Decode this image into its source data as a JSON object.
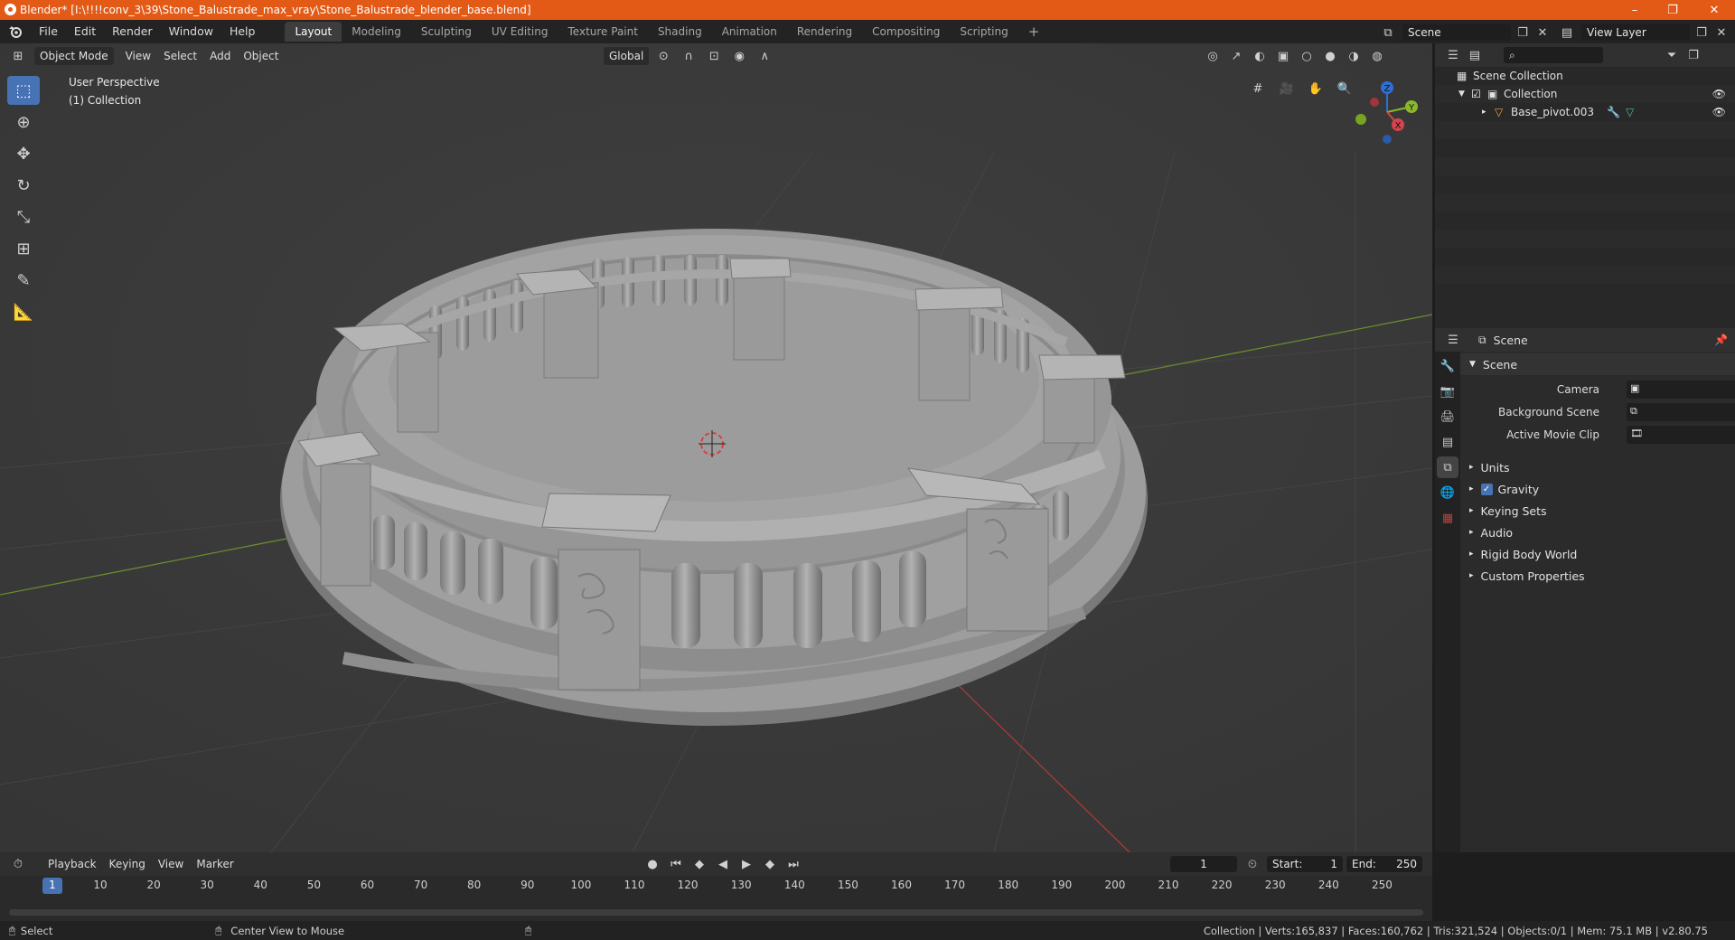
{
  "window": {
    "title": "Blender* [I:\\!!!!conv_3\\39\\Stone_Balustrade_max_vray\\Stone_Balustrade_blender_base.blend]",
    "minimize": "–",
    "maximize": "❐",
    "close": "✕"
  },
  "menubar": {
    "items": [
      "File",
      "Edit",
      "Render",
      "Window",
      "Help"
    ],
    "workspaces": [
      "Layout",
      "Modeling",
      "Sculpting",
      "UV Editing",
      "Texture Paint",
      "Shading",
      "Animation",
      "Rendering",
      "Compositing",
      "Scripting"
    ],
    "add_tab": "+",
    "scene": "Scene",
    "view_layer": "View Layer"
  },
  "viewport": {
    "mode": "Object Mode",
    "menus": [
      "View",
      "Select",
      "Add",
      "Object"
    ],
    "orientation": "Global",
    "perspective": "User Perspective",
    "collection": "(1) Collection",
    "gizmo": {
      "z": "Z",
      "y": "Y",
      "x": "X"
    }
  },
  "outliner": {
    "search_placeholder": "",
    "scene_collection": "Scene Collection",
    "collection": "Collection",
    "object": "Base_pivot.003"
  },
  "properties": {
    "context": "Scene",
    "panel_title": "Scene",
    "camera_label": "Camera",
    "background_scene_label": "Background Scene",
    "active_movie_clip_label": "Active Movie Clip",
    "sections": [
      "Units",
      "Gravity",
      "Keying Sets",
      "Audio",
      "Rigid Body World",
      "Custom Properties"
    ]
  },
  "timeline": {
    "menus": [
      "Playback",
      "Keying",
      "View",
      "Marker"
    ],
    "current_frame": "1",
    "start_label": "Start:",
    "start": "1",
    "end_label": "End:",
    "end": "250",
    "ruler": [
      "1",
      "10",
      "20",
      "30",
      "40",
      "50",
      "60",
      "70",
      "80",
      "90",
      "100",
      "110",
      "120",
      "130",
      "140",
      "150",
      "160",
      "170",
      "180",
      "190",
      "200",
      "210",
      "220",
      "230",
      "240",
      "250"
    ]
  },
  "statusbar": {
    "select": "Select",
    "center_view": "Center View to Mouse",
    "stats": "Collection | Verts:165,837 | Faces:160,762 | Tris:321,524 | Objects:0/1 | Mem: 75.1 MB | v2.80.75"
  }
}
